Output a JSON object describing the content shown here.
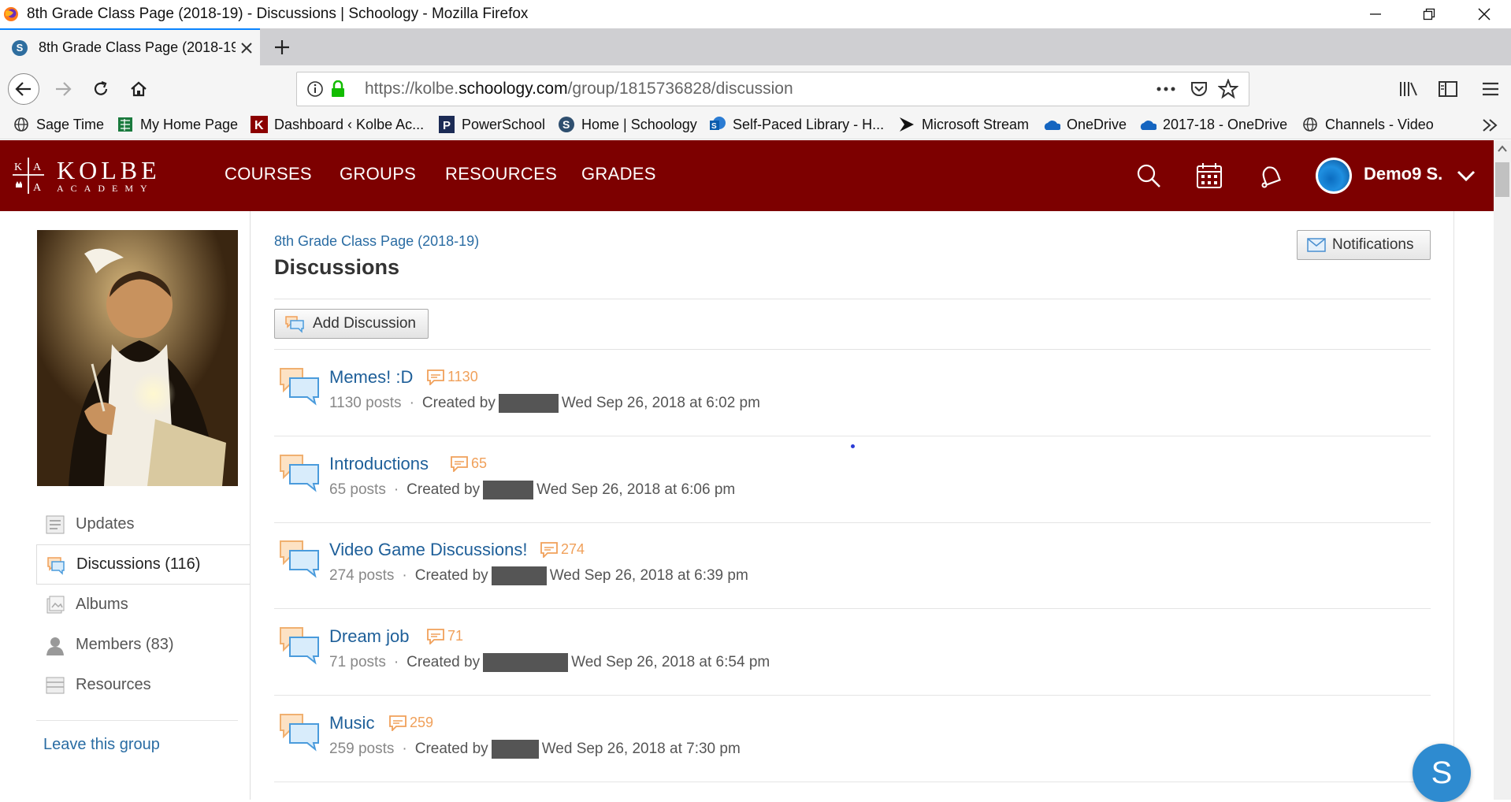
{
  "window": {
    "title": "8th Grade Class Page (2018-19) - Discussions | Schoology - Mozilla Firefox"
  },
  "browser": {
    "tab_title": "8th Grade Class Page (2018-19)",
    "url_prefix": "https://kolbe.",
    "url_domain": "schoology.com",
    "url_path": "/group/1815736828/discussion",
    "bookmarks": [
      {
        "label": "Sage Time",
        "icon": "globe-icon"
      },
      {
        "label": "My Home Page",
        "icon": "spreadsheet-icon"
      },
      {
        "label": "Dashboard ‹ Kolbe Ac...",
        "icon": "k-logo-icon"
      },
      {
        "label": "PowerSchool",
        "icon": "powerschool-icon"
      },
      {
        "label": "Home | Schoology",
        "icon": "schoology-icon"
      },
      {
        "label": "Self-Paced Library - H...",
        "icon": "sharepoint-icon"
      },
      {
        "label": "Microsoft Stream",
        "icon": "stream-icon"
      },
      {
        "label": "OneDrive",
        "icon": "onedrive-icon"
      },
      {
        "label": "2017-18 - OneDrive",
        "icon": "onedrive-icon"
      },
      {
        "label": "Channels - Video",
        "icon": "globe-icon"
      }
    ]
  },
  "header": {
    "logo_main": "KOLBE",
    "logo_sub": "ACADEMY",
    "nav": [
      "COURSES",
      "GROUPS",
      "RESOURCES",
      "GRADES"
    ],
    "user_name": "Demo9 S."
  },
  "sidebar": {
    "items": [
      {
        "label": "Updates"
      },
      {
        "label": "Discussions (116)"
      },
      {
        "label": "Albums"
      },
      {
        "label": "Members (83)"
      },
      {
        "label": "Resources"
      }
    ],
    "leave_link": "Leave this group"
  },
  "main": {
    "breadcrumb": "8th Grade Class Page (2018-19)",
    "title": "Discussions",
    "notifications_label": "Notifications",
    "add_discussion_label": "Add Discussion",
    "created_by_label": "Created by",
    "discussions": [
      {
        "title": "Memes! :D",
        "count": "1130",
        "posts": "1130 posts",
        "date": "Wed Sep 26, 2018 at 6:02 pm"
      },
      {
        "title": "Introductions",
        "count": "65",
        "posts": "65 posts",
        "date": "Wed Sep 26, 2018 at 6:06 pm"
      },
      {
        "title": "Video Game Discussions!",
        "count": "274",
        "posts": "274 posts",
        "date": "Wed Sep 26, 2018 at 6:39 pm"
      },
      {
        "title": "Dream job",
        "count": "71",
        "posts": "71 posts",
        "date": "Wed Sep 26, 2018 at 6:54 pm"
      },
      {
        "title": "Music",
        "count": "259",
        "posts": "259 posts",
        "date": "Wed Sep 26, 2018 at 7:30 pm"
      }
    ]
  },
  "fab_label": "S",
  "colors": {
    "header_bg": "#7d0000",
    "link": "#1e5f99",
    "count_orange": "#f0a05a"
  }
}
